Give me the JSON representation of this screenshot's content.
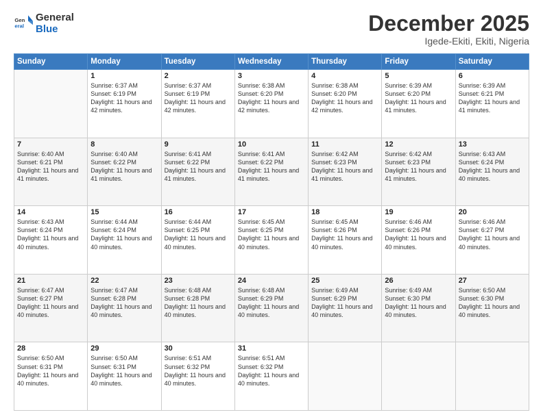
{
  "logo": {
    "line1": "General",
    "line2": "Blue"
  },
  "header": {
    "month": "December 2025",
    "location": "Igede-Ekiti, Ekiti, Nigeria"
  },
  "weekdays": [
    "Sunday",
    "Monday",
    "Tuesday",
    "Wednesday",
    "Thursday",
    "Friday",
    "Saturday"
  ],
  "weeks": [
    [
      {
        "day": "",
        "sunrise": "",
        "sunset": "",
        "daylight": ""
      },
      {
        "day": "1",
        "sunrise": "Sunrise: 6:37 AM",
        "sunset": "Sunset: 6:19 PM",
        "daylight": "Daylight: 11 hours and 42 minutes."
      },
      {
        "day": "2",
        "sunrise": "Sunrise: 6:37 AM",
        "sunset": "Sunset: 6:19 PM",
        "daylight": "Daylight: 11 hours and 42 minutes."
      },
      {
        "day": "3",
        "sunrise": "Sunrise: 6:38 AM",
        "sunset": "Sunset: 6:20 PM",
        "daylight": "Daylight: 11 hours and 42 minutes."
      },
      {
        "day": "4",
        "sunrise": "Sunrise: 6:38 AM",
        "sunset": "Sunset: 6:20 PM",
        "daylight": "Daylight: 11 hours and 42 minutes."
      },
      {
        "day": "5",
        "sunrise": "Sunrise: 6:39 AM",
        "sunset": "Sunset: 6:20 PM",
        "daylight": "Daylight: 11 hours and 41 minutes."
      },
      {
        "day": "6",
        "sunrise": "Sunrise: 6:39 AM",
        "sunset": "Sunset: 6:21 PM",
        "daylight": "Daylight: 11 hours and 41 minutes."
      }
    ],
    [
      {
        "day": "7",
        "sunrise": "Sunrise: 6:40 AM",
        "sunset": "Sunset: 6:21 PM",
        "daylight": "Daylight: 11 hours and 41 minutes."
      },
      {
        "day": "8",
        "sunrise": "Sunrise: 6:40 AM",
        "sunset": "Sunset: 6:22 PM",
        "daylight": "Daylight: 11 hours and 41 minutes."
      },
      {
        "day": "9",
        "sunrise": "Sunrise: 6:41 AM",
        "sunset": "Sunset: 6:22 PM",
        "daylight": "Daylight: 11 hours and 41 minutes."
      },
      {
        "day": "10",
        "sunrise": "Sunrise: 6:41 AM",
        "sunset": "Sunset: 6:22 PM",
        "daylight": "Daylight: 11 hours and 41 minutes."
      },
      {
        "day": "11",
        "sunrise": "Sunrise: 6:42 AM",
        "sunset": "Sunset: 6:23 PM",
        "daylight": "Daylight: 11 hours and 41 minutes."
      },
      {
        "day": "12",
        "sunrise": "Sunrise: 6:42 AM",
        "sunset": "Sunset: 6:23 PM",
        "daylight": "Daylight: 11 hours and 41 minutes."
      },
      {
        "day": "13",
        "sunrise": "Sunrise: 6:43 AM",
        "sunset": "Sunset: 6:24 PM",
        "daylight": "Daylight: 11 hours and 40 minutes."
      }
    ],
    [
      {
        "day": "14",
        "sunrise": "Sunrise: 6:43 AM",
        "sunset": "Sunset: 6:24 PM",
        "daylight": "Daylight: 11 hours and 40 minutes."
      },
      {
        "day": "15",
        "sunrise": "Sunrise: 6:44 AM",
        "sunset": "Sunset: 6:24 PM",
        "daylight": "Daylight: 11 hours and 40 minutes."
      },
      {
        "day": "16",
        "sunrise": "Sunrise: 6:44 AM",
        "sunset": "Sunset: 6:25 PM",
        "daylight": "Daylight: 11 hours and 40 minutes."
      },
      {
        "day": "17",
        "sunrise": "Sunrise: 6:45 AM",
        "sunset": "Sunset: 6:25 PM",
        "daylight": "Daylight: 11 hours and 40 minutes."
      },
      {
        "day": "18",
        "sunrise": "Sunrise: 6:45 AM",
        "sunset": "Sunset: 6:26 PM",
        "daylight": "Daylight: 11 hours and 40 minutes."
      },
      {
        "day": "19",
        "sunrise": "Sunrise: 6:46 AM",
        "sunset": "Sunset: 6:26 PM",
        "daylight": "Daylight: 11 hours and 40 minutes."
      },
      {
        "day": "20",
        "sunrise": "Sunrise: 6:46 AM",
        "sunset": "Sunset: 6:27 PM",
        "daylight": "Daylight: 11 hours and 40 minutes."
      }
    ],
    [
      {
        "day": "21",
        "sunrise": "Sunrise: 6:47 AM",
        "sunset": "Sunset: 6:27 PM",
        "daylight": "Daylight: 11 hours and 40 minutes."
      },
      {
        "day": "22",
        "sunrise": "Sunrise: 6:47 AM",
        "sunset": "Sunset: 6:28 PM",
        "daylight": "Daylight: 11 hours and 40 minutes."
      },
      {
        "day": "23",
        "sunrise": "Sunrise: 6:48 AM",
        "sunset": "Sunset: 6:28 PM",
        "daylight": "Daylight: 11 hours and 40 minutes."
      },
      {
        "day": "24",
        "sunrise": "Sunrise: 6:48 AM",
        "sunset": "Sunset: 6:29 PM",
        "daylight": "Daylight: 11 hours and 40 minutes."
      },
      {
        "day": "25",
        "sunrise": "Sunrise: 6:49 AM",
        "sunset": "Sunset: 6:29 PM",
        "daylight": "Daylight: 11 hours and 40 minutes."
      },
      {
        "day": "26",
        "sunrise": "Sunrise: 6:49 AM",
        "sunset": "Sunset: 6:30 PM",
        "daylight": "Daylight: 11 hours and 40 minutes."
      },
      {
        "day": "27",
        "sunrise": "Sunrise: 6:50 AM",
        "sunset": "Sunset: 6:30 PM",
        "daylight": "Daylight: 11 hours and 40 minutes."
      }
    ],
    [
      {
        "day": "28",
        "sunrise": "Sunrise: 6:50 AM",
        "sunset": "Sunset: 6:31 PM",
        "daylight": "Daylight: 11 hours and 40 minutes."
      },
      {
        "day": "29",
        "sunrise": "Sunrise: 6:50 AM",
        "sunset": "Sunset: 6:31 PM",
        "daylight": "Daylight: 11 hours and 40 minutes."
      },
      {
        "day": "30",
        "sunrise": "Sunrise: 6:51 AM",
        "sunset": "Sunset: 6:32 PM",
        "daylight": "Daylight: 11 hours and 40 minutes."
      },
      {
        "day": "31",
        "sunrise": "Sunrise: 6:51 AM",
        "sunset": "Sunset: 6:32 PM",
        "daylight": "Daylight: 11 hours and 40 minutes."
      },
      {
        "day": "",
        "sunrise": "",
        "sunset": "",
        "daylight": ""
      },
      {
        "day": "",
        "sunrise": "",
        "sunset": "",
        "daylight": ""
      },
      {
        "day": "",
        "sunrise": "",
        "sunset": "",
        "daylight": ""
      }
    ]
  ]
}
